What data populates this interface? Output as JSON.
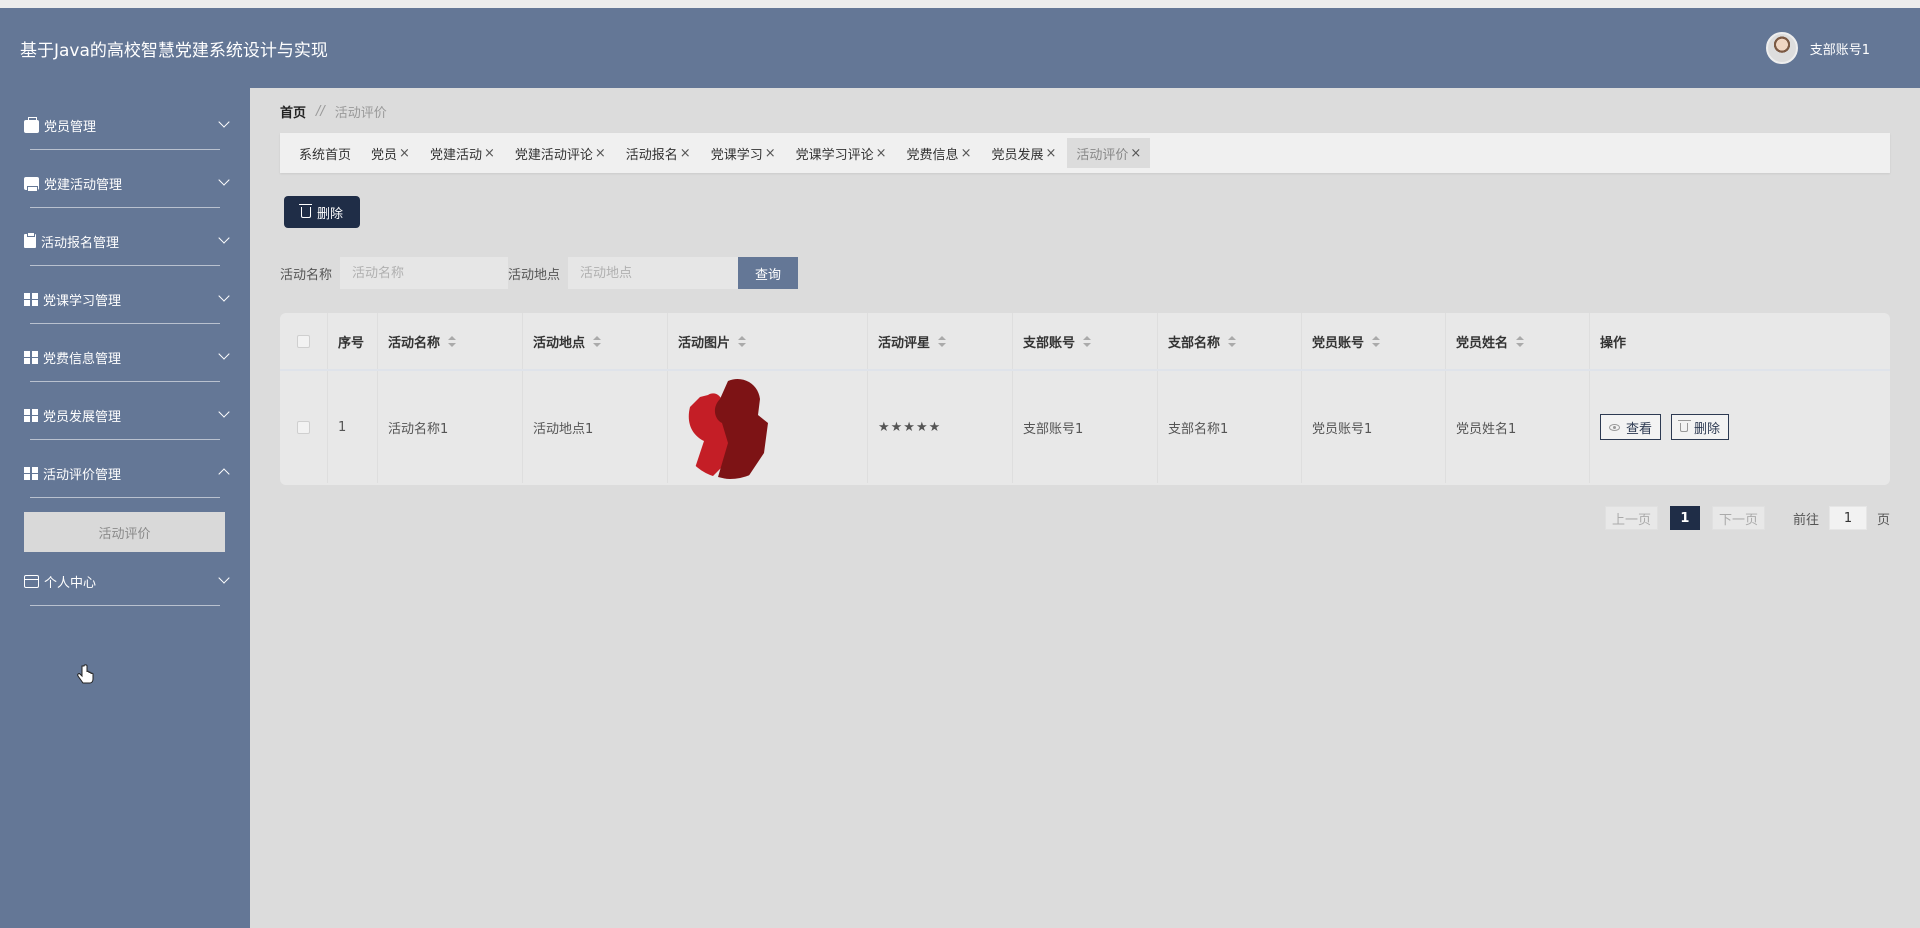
{
  "header": {
    "app_title": "基于Java的高校智慧党建系统设计与实现",
    "user_name": "支部账号1"
  },
  "sidebar": {
    "items": [
      {
        "label": "党员管理",
        "icon": "briefcase-icon"
      },
      {
        "label": "党建活动管理",
        "icon": "printer-icon"
      },
      {
        "label": "活动报名管理",
        "icon": "clipboard-icon"
      },
      {
        "label": "党课学习管理",
        "icon": "grid-icon"
      },
      {
        "label": "党费信息管理",
        "icon": "grid-icon"
      },
      {
        "label": "党员发展管理",
        "icon": "grid-icon"
      },
      {
        "label": "活动评价管理",
        "icon": "grid-icon",
        "expanded": true
      },
      {
        "label": "个人中心",
        "icon": "card-icon"
      }
    ],
    "active_subitem": "活动评价"
  },
  "breadcrumb": {
    "home": "首页",
    "separator": "//",
    "current": "活动评价"
  },
  "tabs": [
    {
      "label": "系统首页",
      "closable": false
    },
    {
      "label": "党员",
      "closable": true
    },
    {
      "label": "党建活动",
      "closable": true
    },
    {
      "label": "党建活动评论",
      "closable": true
    },
    {
      "label": "活动报名",
      "closable": true
    },
    {
      "label": "党课学习",
      "closable": true
    },
    {
      "label": "党课学习评论",
      "closable": true
    },
    {
      "label": "党费信息",
      "closable": true
    },
    {
      "label": "党员发展",
      "closable": true
    },
    {
      "label": "活动评价",
      "closable": true,
      "active": true
    }
  ],
  "tab_close": "×",
  "toolbar": {
    "delete_label": "删除"
  },
  "search": {
    "name_label": "活动名称",
    "name_placeholder": "活动名称",
    "place_label": "活动地点",
    "place_placeholder": "活动地点",
    "query_label": "查询"
  },
  "table": {
    "columns": [
      "序号",
      "活动名称",
      "活动地点",
      "活动图片",
      "活动评星",
      "支部账号",
      "支部名称",
      "党员账号",
      "党员姓名",
      "操作"
    ],
    "rows": [
      {
        "seq": "1",
        "name": "活动名称1",
        "place": "活动地点1",
        "stars": "★★★★★",
        "branch_account": "支部账号1",
        "branch_name": "支部名称1",
        "member_account": "党员账号1",
        "member_name": "党员姓名1",
        "view_label": "查看",
        "delete_label": "删除"
      }
    ]
  },
  "pagination": {
    "prev": "上一页",
    "current": "1",
    "next": "下一页",
    "goto_label": "前往",
    "goto_value": "1",
    "unit": "页"
  },
  "colors": {
    "header_bg": "#647796",
    "dark_button": "#1f2d47",
    "query_button": "#647796",
    "thumbnail_red": "#c41e26",
    "thumbnail_dark": "#7d1315"
  }
}
